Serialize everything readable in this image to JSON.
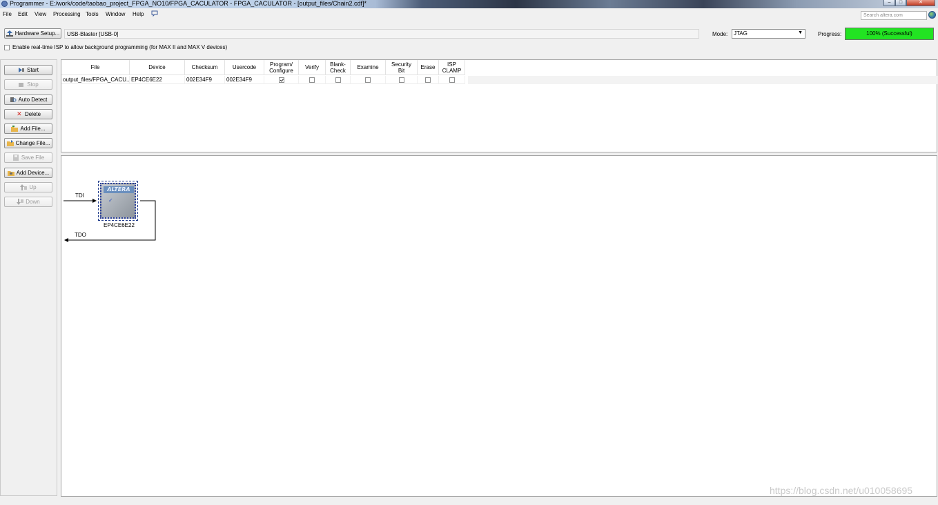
{
  "window": {
    "title": "Programmer - E:/work/code/taobao_project_FPGA_NO10/FPGA_CACULATOR - FPGA_CACULATOR - [output_files/Chain2.cdf]*",
    "minimize_glyph": "–",
    "maximize_glyph": "□",
    "close_glyph": "✕"
  },
  "menu": {
    "items": [
      "File",
      "Edit",
      "View",
      "Processing",
      "Tools",
      "Window",
      "Help"
    ],
    "help_icon": "help-context-icon",
    "search_placeholder": "Search altera.com"
  },
  "hardware": {
    "setup_button": "Hardware Setup...",
    "selected": "USB-Blaster [USB-0]",
    "mode_label": "Mode:",
    "mode_value": "JTAG",
    "progress_label": "Progress:",
    "progress_text": "100% (Successful)",
    "progress_fraction": 1.0,
    "progress_color": "#22e322"
  },
  "isp": {
    "label": "Enable real-time ISP to allow background programming (for MAX II and MAX V devices)",
    "checked": false
  },
  "sidebar": {
    "buttons": [
      {
        "label": "Start",
        "icon": "start-icon",
        "enabled": true
      },
      {
        "label": "Stop",
        "icon": "stop-icon",
        "enabled": false
      },
      {
        "label": "Auto Detect",
        "icon": "auto-detect-icon",
        "enabled": true
      },
      {
        "label": "Delete",
        "icon": "delete-icon",
        "enabled": true
      },
      {
        "label": "Add File...",
        "icon": "add-file-icon",
        "enabled": true
      },
      {
        "label": "Change File...",
        "icon": "change-file-icon",
        "enabled": true
      },
      {
        "label": "Save File",
        "icon": "save-file-icon",
        "enabled": false
      },
      {
        "label": "Add Device...",
        "icon": "add-device-icon",
        "enabled": true
      },
      {
        "label": "Up",
        "icon": "up-icon",
        "enabled": false
      },
      {
        "label": "Down",
        "icon": "down-icon",
        "enabled": false
      }
    ]
  },
  "table": {
    "columns": [
      "File",
      "Device",
      "Checksum",
      "Usercode",
      "Program/\nConfigure",
      "Verify",
      "Blank-\nCheck",
      "Examine",
      "Security\nBit",
      "Erase",
      "ISP\nCLAMP"
    ],
    "rows": [
      {
        "file": "output_files/FPGA_CACU...",
        "device": "EP4CE6E22",
        "checksum": "002E34F9",
        "usercode": "002E34F9",
        "program_configure": true,
        "verify": false,
        "blank_check": false,
        "examine": false,
        "security_bit": false,
        "erase": false,
        "isp_clamp": false
      }
    ]
  },
  "chain": {
    "tdi_label": "TDI",
    "tdo_label": "TDO",
    "device_label": "EP4CE6E22",
    "logo_text": "ALTERA",
    "check_glyph": "✓"
  },
  "watermark": "https://blog.csdn.net/u010058695"
}
